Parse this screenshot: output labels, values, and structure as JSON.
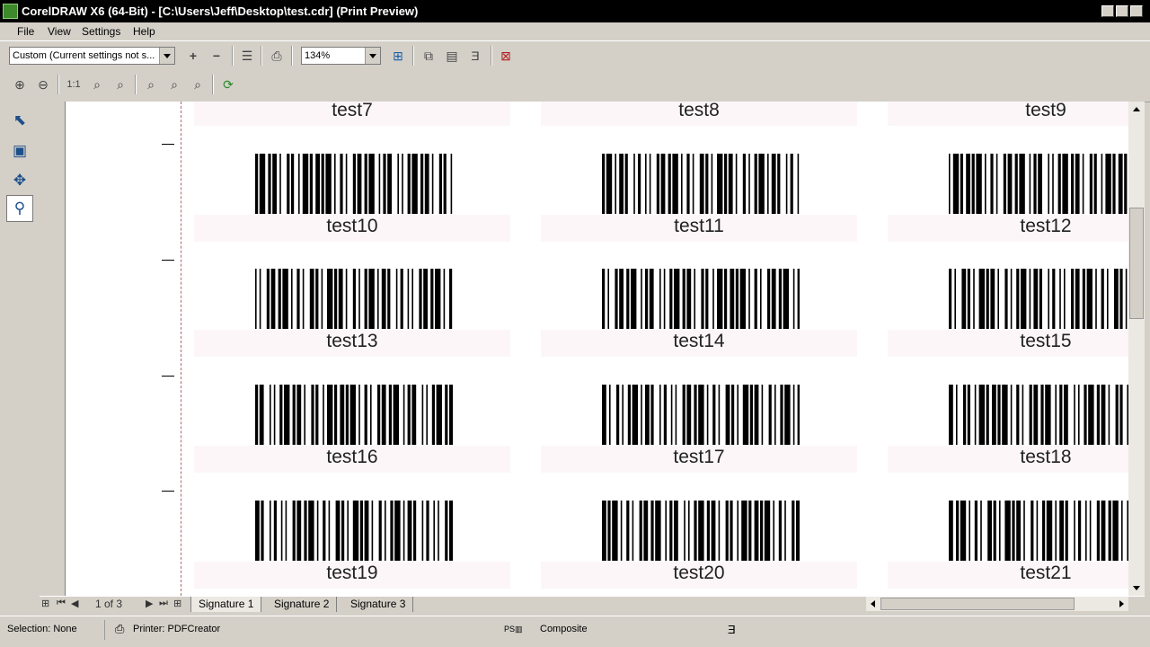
{
  "window": {
    "title": "CorelDRAW X6 (64-Bit) - [C:\\Users\\Jeff\\Desktop\\test.cdr] (Print Preview)"
  },
  "menu": [
    "File",
    "View",
    "Settings",
    "Help"
  ],
  "toolbar": {
    "print_style": "Custom (Current settings not s...",
    "zoom": "134%"
  },
  "page_nav": {
    "page_indicator": "1 of 3",
    "tabs": [
      "Signature 1",
      "Signature 2",
      "Signature 3"
    ]
  },
  "status": {
    "selection": "Selection: None",
    "printer": "Printer: PDFCreator",
    "composite": "Composite"
  },
  "labels": [
    "test7",
    "test8",
    "test9",
    "test10",
    "test11",
    "test12",
    "test13",
    "test14",
    "test15",
    "test16",
    "test17",
    "test18",
    "test19",
    "test20",
    "test21"
  ]
}
